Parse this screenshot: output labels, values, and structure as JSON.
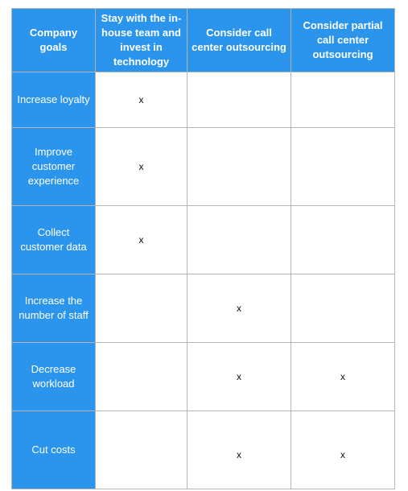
{
  "table": {
    "headers": [
      "Company goals",
      "Stay with the in-house team and invest in technology",
      "Consider call center outsourcing",
      "Consider partial call center outsourcing"
    ],
    "rows": [
      {
        "goal": "Increase loyalty",
        "cells": [
          "x",
          "",
          ""
        ]
      },
      {
        "goal": "Improve customer experience",
        "cells": [
          "x",
          "",
          ""
        ]
      },
      {
        "goal": "Collect customer data",
        "cells": [
          "x",
          "",
          ""
        ]
      },
      {
        "goal": "Increase the number of staff",
        "cells": [
          "",
          "x",
          ""
        ]
      },
      {
        "goal": "Decrease workload",
        "cells": [
          "",
          "x",
          "x"
        ]
      },
      {
        "goal": "Cut costs",
        "cells": [
          "",
          "x",
          "x"
        ]
      }
    ]
  },
  "colors": {
    "header_bg": "#2b95ee",
    "border": "#b5b5b5"
  }
}
